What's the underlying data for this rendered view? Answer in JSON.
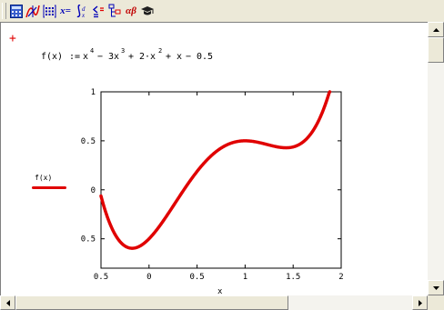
{
  "toolbar": {
    "buttons": [
      {
        "name": "calculator",
        "icon": "calculator-icon"
      },
      {
        "name": "graph",
        "icon": "graph-icon"
      },
      {
        "name": "matrix",
        "icon": "matrix-icon"
      },
      {
        "name": "evaluation",
        "icon": "x-equals-icon",
        "text": "x="
      },
      {
        "name": "calculus",
        "icon": "integral-icon",
        "text": "∫"
      },
      {
        "name": "boolean",
        "icon": "boolean-icon"
      },
      {
        "name": "programming",
        "icon": "programming-icon"
      },
      {
        "name": "greek",
        "icon": "greek-icon",
        "text": "αβ"
      },
      {
        "name": "symbolic",
        "icon": "graduation-cap-icon"
      }
    ]
  },
  "worksheet": {
    "cursor_glyph": "+",
    "definition": {
      "lhs": "f(x)",
      "assign": ":=",
      "terms": [
        "x",
        "4",
        "−",
        "3x",
        "3",
        "+",
        "2·x",
        "2",
        "+",
        "x",
        "−",
        "0.5"
      ]
    },
    "legend": {
      "label": "f(x)",
      "color": "#e00000"
    },
    "x_axis_label": "x"
  },
  "chart_data": {
    "type": "line",
    "series": [
      {
        "name": "f(x)",
        "color": "#e00000"
      }
    ],
    "expression": "x^4 - 3x^3 + 2x^2 + x - 0.5",
    "xlim": [
      -0.5,
      2
    ],
    "ylim": [
      -0.8,
      1
    ],
    "xticks": [
      -0.5,
      0,
      0.5,
      1,
      1.5,
      2
    ],
    "xtick_labels": [
      "0.5",
      "0",
      "0.5",
      "1",
      "1.5",
      "2"
    ],
    "yticks": [
      -0.5,
      0,
      0.5,
      1
    ],
    "ytick_labels": [
      "0.5",
      "0",
      "0.5",
      "1"
    ],
    "grid": false
  },
  "colors": {
    "curve": "#e00000",
    "window": "#ece9d8",
    "toolbar_icon": "#0000b8"
  }
}
